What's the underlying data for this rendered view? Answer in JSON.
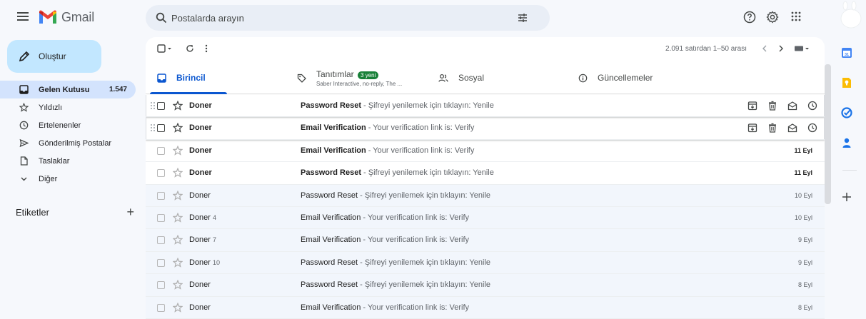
{
  "app": {
    "name": "Gmail"
  },
  "search": {
    "placeholder": "Postalarda arayın"
  },
  "sidebar": {
    "compose_label": "Oluştur",
    "items": [
      {
        "label": "Gelen Kutusu",
        "count": "1.547",
        "icon": "inbox-icon"
      },
      {
        "label": "Yıldızlı",
        "count": "",
        "icon": "star-icon"
      },
      {
        "label": "Ertelenenler",
        "count": "",
        "icon": "clock-icon"
      },
      {
        "label": "Gönderilmiş Postalar",
        "count": "",
        "icon": "send-icon"
      },
      {
        "label": "Taslaklar",
        "count": "",
        "icon": "draft-icon"
      },
      {
        "label": "Diğer",
        "count": "",
        "icon": "chevron-down-icon"
      }
    ],
    "labels_title": "Etiketler"
  },
  "toolbar": {
    "range_text": "2.091 satırdan 1–50 arası"
  },
  "tabs": [
    {
      "label": "Birincil",
      "icon": "inbox-icon",
      "active": true
    },
    {
      "label": "Tanıtımlar",
      "badge": "3 yeni",
      "sub": "Saber Interactive, no-reply, The ...",
      "icon": "tag-icon"
    },
    {
      "label": "Sosyal",
      "icon": "people-icon"
    },
    {
      "label": "Güncellemeler",
      "icon": "info-icon"
    }
  ],
  "emails": [
    {
      "sender": "Doner",
      "count": "",
      "title": "Password Reset",
      "snippet": " - Şifreyi yenilemek için tıklayın: Yenile",
      "date": "",
      "unread": true,
      "hover": true
    },
    {
      "sender": "Doner",
      "count": "",
      "title": "Email Verification",
      "snippet": " - Your verification link is: Verify",
      "date": "",
      "unread": true,
      "hover": true
    },
    {
      "sender": "Doner",
      "count": "",
      "title": "Email Verification",
      "snippet": " - Your verification link is: Verify",
      "date": "11 Eyl",
      "unread": true,
      "hover": false
    },
    {
      "sender": "Doner",
      "count": "",
      "title": "Password Reset",
      "snippet": " - Şifreyi yenilemek için tıklayın: Yenile",
      "date": "11 Eyl",
      "unread": true,
      "hover": false
    },
    {
      "sender": "Doner",
      "count": "",
      "title": "Password Reset",
      "snippet": " - Şifreyi yenilemek için tıklayın: Yenile",
      "date": "10 Eyl",
      "unread": false,
      "hover": false
    },
    {
      "sender": "Doner",
      "count": "4",
      "title": "Email Verification",
      "snippet": " - Your verification link is: Verify",
      "date": "10 Eyl",
      "unread": false,
      "hover": false
    },
    {
      "sender": "Doner",
      "count": "7",
      "title": "Email Verification",
      "snippet": " - Your verification link is: Verify",
      "date": "9 Eyl",
      "unread": false,
      "hover": false
    },
    {
      "sender": "Doner",
      "count": "10",
      "title": "Password Reset",
      "snippet": " - Şifreyi yenilemek için tıklayın: Yenile",
      "date": "9 Eyl",
      "unread": false,
      "hover": false
    },
    {
      "sender": "Doner",
      "count": "",
      "title": "Password Reset",
      "snippet": " - Şifreyi yenilemek için tıklayın: Yenile",
      "date": "8 Eyl",
      "unread": false,
      "hover": false
    },
    {
      "sender": "Doner",
      "count": "",
      "title": "Email Verification",
      "snippet": " - Your verification link is: Verify",
      "date": "8 Eyl",
      "unread": false,
      "hover": false
    }
  ],
  "colors": {
    "accent": "#0b57d0",
    "compose": "#c2e7ff",
    "active_nav": "#d3e3fd",
    "badge": "#188038",
    "read_row": "#f2f6fc"
  }
}
